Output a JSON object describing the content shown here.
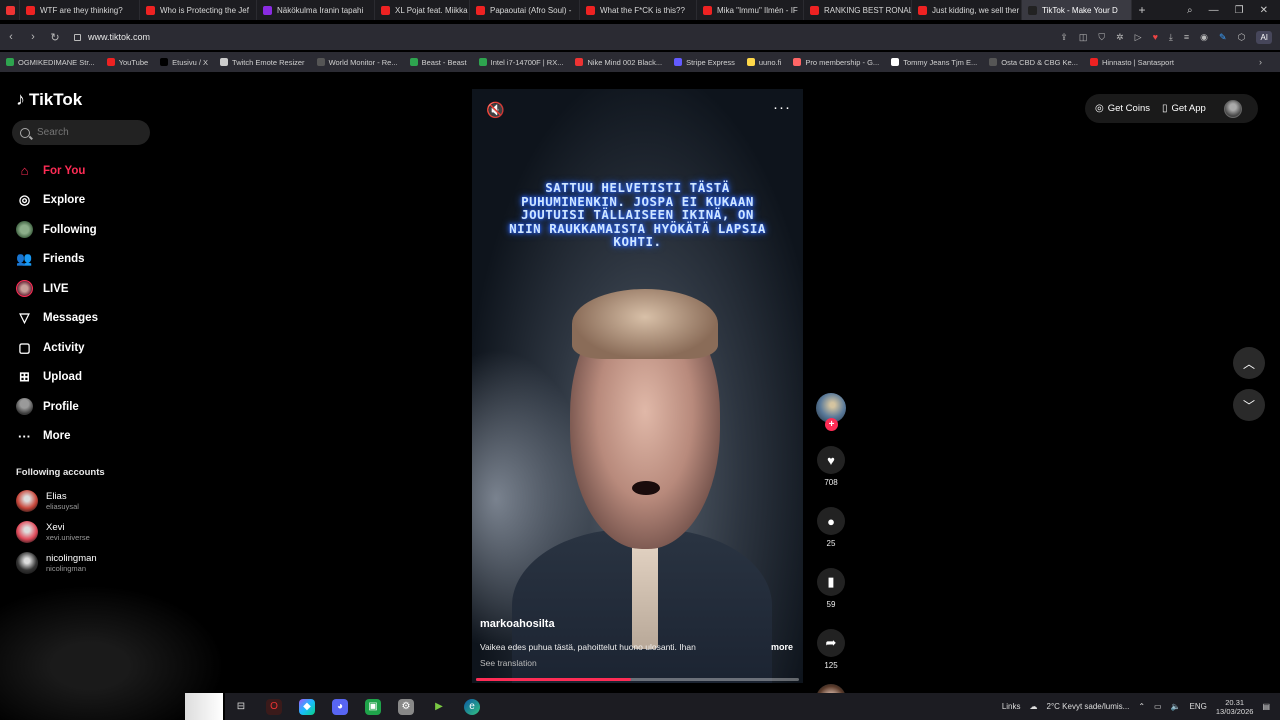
{
  "browser": {
    "tabs": [
      {
        "title": "WTF are they thinking?",
        "color": "#e22"
      },
      {
        "title": "Who is Protecting the Jef",
        "color": "#e22"
      },
      {
        "title": "Näkökulma Iranin tapahi",
        "color": "#8a2be2"
      },
      {
        "title": "XL Pojat feat. Miikka Ka",
        "color": "#e22"
      },
      {
        "title": "Papaoutai (Afro Soul) -",
        "color": "#e22"
      },
      {
        "title": "What the F*CK is this??",
        "color": "#e22"
      },
      {
        "title": "Mika \"Immu\" Ilmén - IF",
        "color": "#e22"
      },
      {
        "title": "RANKING BEST RONALD",
        "color": "#e22"
      },
      {
        "title": "Just kidding, we sell ther",
        "color": "#e22"
      },
      {
        "title": "TikTok - Make Your D",
        "color": "#222"
      }
    ],
    "url": "www.tiktok.com",
    "ai_label": "AI",
    "bookmarks": [
      {
        "label": "OGMIKEDIMANE Str...",
        "color": "#2ea44f"
      },
      {
        "label": "YouTube",
        "color": "#e22"
      },
      {
        "label": "Etusivu / X",
        "color": "#000"
      },
      {
        "label": "Twitch Emote Resizer",
        "color": "#ccc"
      },
      {
        "label": "World Monitor - Re...",
        "color": "#555"
      },
      {
        "label": "Beast - Beast",
        "color": "#2ea44f"
      },
      {
        "label": "Intel i7-14700F | RX...",
        "color": "#2ea44f"
      },
      {
        "label": "Nike Mind 002 Black...",
        "color": "#e33"
      },
      {
        "label": "Stripe Express",
        "color": "#635bff"
      },
      {
        "label": "uuno.fi",
        "color": "#ffd84a"
      },
      {
        "label": "Pro membership - G...",
        "color": "#f66"
      },
      {
        "label": "Tommy Jeans Tjm E...",
        "color": "#fff"
      },
      {
        "label": "Osta CBD & CBG Ke...",
        "color": "#555"
      },
      {
        "label": "Hinnasto | Santasport",
        "color": "#e22"
      }
    ]
  },
  "tiktok": {
    "logo": "TikTok",
    "search_placeholder": "Search",
    "nav": [
      {
        "label": "For You",
        "icon": "home-icon",
        "glyph": "⌂",
        "active": true
      },
      {
        "label": "Explore",
        "icon": "compass-icon",
        "glyph": "◎"
      },
      {
        "label": "Following",
        "icon": "following-avatar-icon",
        "glyph": ""
      },
      {
        "label": "Friends",
        "icon": "friends-icon",
        "glyph": "👥"
      },
      {
        "label": "LIVE",
        "icon": "live-avatar-icon",
        "glyph": ""
      },
      {
        "label": "Messages",
        "icon": "messages-icon",
        "glyph": "▽"
      },
      {
        "label": "Activity",
        "icon": "activity-icon",
        "glyph": "▢"
      },
      {
        "label": "Upload",
        "icon": "upload-icon",
        "glyph": "⊞"
      },
      {
        "label": "Profile",
        "icon": "profile-avatar-icon",
        "glyph": ""
      },
      {
        "label": "More",
        "icon": "more-icon",
        "glyph": "···"
      }
    ],
    "following_title": "Following accounts",
    "following": [
      {
        "name": "Elias",
        "handle": "eliasuysal",
        "color": "#c8463a"
      },
      {
        "name": "Xevi",
        "handle": "xevi.universe",
        "color": "#e04a5a"
      },
      {
        "name": "nicolingman",
        "handle": "nicolingman",
        "color": "#333"
      }
    ],
    "top_right": {
      "coins": "Get Coins",
      "app": "Get App"
    },
    "video": {
      "caption": "SATTUU HELVETISTI TÄSTÄ PUHUMINENKIN. JOSPA EI KUKAAN JOUTUISI TÄLLAISEEN IKINÄ, ON NIIN RAUKKAMAISTA HYÖKÄTÄ LAPSIA KOHTI.",
      "author": "markoahosilta",
      "description": "Vaikea edes puhua tästä, pahoittelut huono ulosanti. Ihan",
      "more": "more",
      "translate": "See translation",
      "progress": 0.48
    },
    "actions": {
      "likes": "708",
      "comments": "25",
      "saves": "59",
      "shares": "125"
    }
  },
  "taskbar": {
    "links": "Links",
    "weather": "2°C  Kevyt sade/lumis...",
    "lang": "ENG",
    "time": "20.31",
    "date": "13/03/2026"
  }
}
